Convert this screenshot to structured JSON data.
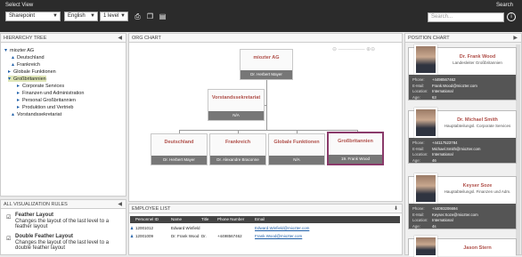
{
  "toolbar": {
    "select_view_label": "Select View",
    "view_select": "Sharepoint",
    "language_select": "English",
    "level_select": "1 level",
    "search_label": "Search",
    "search_placeholder": "Search..."
  },
  "hierarchy": {
    "title": "HIERARCHY TREE",
    "items": [
      "miozter AG",
      "Deutschland",
      "Frankreich",
      "Globale Funktionen",
      "Großbritannien",
      "Corporate Services",
      "Finanzen und Administration",
      "Personal Großbritannien",
      "Produktion und Vertrieb",
      "Vorstandssekretariat"
    ]
  },
  "rules": {
    "title": "ALL VISUALIZATION RULES",
    "items": [
      {
        "name": "Feather Layout",
        "desc": "Changes the layout of the last level to a feather layout"
      },
      {
        "name": "Double Feather Layout",
        "desc": "Changes the layout of the last level to a double feather layout"
      }
    ]
  },
  "org": {
    "title": "ORG CHART",
    "root": {
      "title": "miozter AG",
      "person": "Dr. Herbert Mayer"
    },
    "secretary": {
      "title": "Vorstandssekretariat",
      "person": "N/A"
    },
    "children": [
      {
        "title": "Deutschland",
        "person": "Dr. Herbert Mayer"
      },
      {
        "title": "Frankreich",
        "person": "Dr. Alexandre Braconne"
      },
      {
        "title": "Globale Funktionen",
        "person": "N/A"
      },
      {
        "title": "Großbritannien",
        "person": "19. Frank Wood"
      }
    ]
  },
  "employees": {
    "title": "EMPLOYEE LIST",
    "columns": [
      "Personnel ID",
      "Name",
      "Title",
      "Phone Number",
      "Email"
    ],
    "rows": [
      {
        "id": "12001012",
        "name": "Edward Winfield",
        "title": "",
        "phone": "",
        "email": "Edward.Winfield@miozter.com"
      },
      {
        "id": "12001009",
        "name": "Dr. Frank Wood",
        "title": "Dr.",
        "phone": "+4498567462",
        "email": "Frank.Wood@miozter.com"
      }
    ]
  },
  "position": {
    "title": "POSITION CHART",
    "cards": [
      {
        "name": "Dr. Frank Wood",
        "role": "Landesleiter Großbritannien",
        "phone": "+4498567462",
        "email": "Frank.Wood@miozter.com",
        "location": "International",
        "age": "63"
      },
      {
        "name": "Dr. Michael Smith",
        "role": "Hauptabteilungsl. Corporate Services",
        "phone": "+44117523784",
        "email": "Michael.Smith@miozter.com",
        "location": "International",
        "age": "46"
      },
      {
        "name": "Keyser Soze",
        "role": "Hauptabteilungsl. Finanzen und Adm.",
        "phone": "+44093206694",
        "email": "Keyser.Soze@miozter.com",
        "location": "International",
        "age": "4s"
      },
      {
        "name": "Jason Stern",
        "role": "",
        "phone": "",
        "email": "",
        "location": "",
        "age": ""
      }
    ],
    "labels": {
      "phone": "Phone:",
      "email": "E-Mail:",
      "location": "Location:",
      "age": "Age:"
    }
  }
}
